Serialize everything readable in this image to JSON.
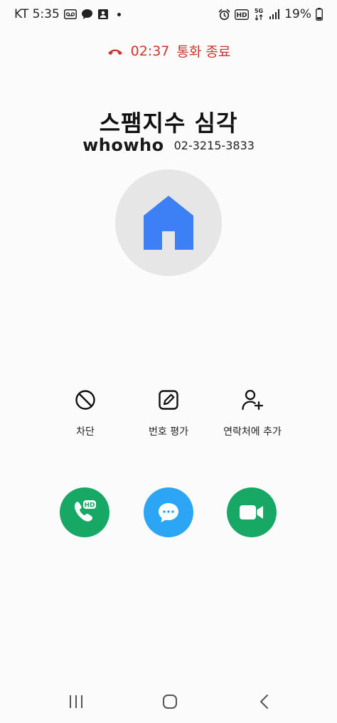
{
  "status_bar": {
    "carrier_time": "KT 5:35",
    "battery": "19%",
    "network_hd": "HD",
    "network_5g": "5G"
  },
  "call_status": {
    "duration": "02:37",
    "label": "통화 종료",
    "color": "#c8372d"
  },
  "caller": {
    "name": "스팸지수 심각",
    "brand": "whowho",
    "number": "02-3215-3833"
  },
  "avatar": {
    "icon": "home-icon",
    "color": "#3d80f5"
  },
  "actions": [
    {
      "label": "차단",
      "icon": "block-icon"
    },
    {
      "label": "번호 평가",
      "icon": "edit-icon"
    },
    {
      "label": "연락처에 추가",
      "icon": "add-contact-icon"
    }
  ],
  "call_buttons": {
    "voice": {
      "icon": "hd-voice-call-icon",
      "badge": "HD",
      "color": "#17a865"
    },
    "message": {
      "icon": "message-icon",
      "color": "#2ca5f5"
    },
    "video": {
      "icon": "video-call-icon",
      "color": "#17a865"
    }
  },
  "nav": {
    "recents": "recent-apps-icon",
    "home": "home-button-icon",
    "back": "back-icon"
  }
}
